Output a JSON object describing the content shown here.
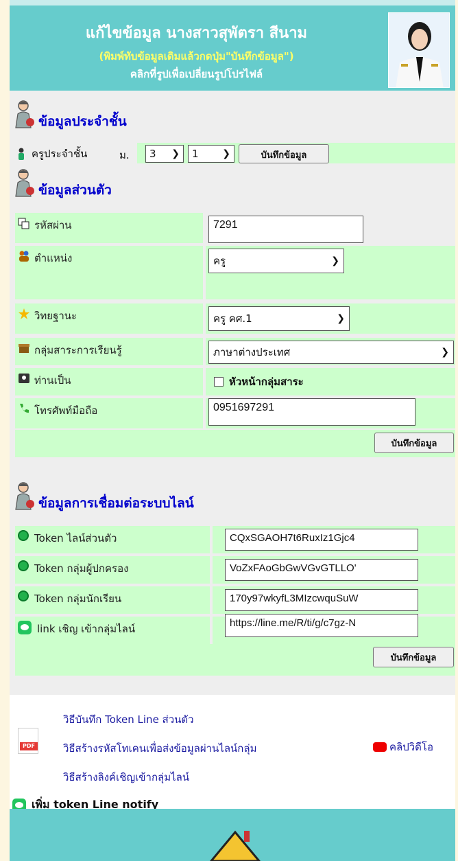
{
  "header": {
    "title": "แก้ไขข้อมูล นางสาวสุพัตรา สีนาม",
    "subtitle": "(พิมพ์ทับข้อมูลเดิมแล้วกดปุ่ม\"บันทึกข้อมูล\")",
    "click_hint": "คลิกที่รูปเพื่อเปลี่ยนรูปโปรไฟล์"
  },
  "class_section": {
    "title": "ข้อมูลประจำชั้น",
    "teacher_label": "ครูประจำชั้น",
    "level_prefix": "ม.",
    "level_value": "3",
    "room_value": "1",
    "save_label": "บันทึกข้อมูล"
  },
  "personal_section": {
    "title": "ข้อมูลส่วนตัว",
    "password_label": "รหัสผ่าน",
    "password_value": "7291",
    "position_label": "ตำแหน่ง",
    "position_value": "ครู",
    "rank_label": "วิทยฐานะ",
    "rank_value": "ครู คศ.1",
    "group_label": "กลุ่มสาระการเรียนรู้",
    "group_value": "ภาษาต่างประเทศ",
    "role_label": "ท่านเป็น",
    "role_option": "หัวหน้ากลุ่มสาระ",
    "phone_label": "โทรศัพท์มือถือ",
    "phone_value": "0951697291",
    "save_label": "บันทึกข้อมูล"
  },
  "line_section": {
    "title": "ข้อมูลการเชื่อมต่อระบบไลน์",
    "rows": [
      {
        "label": "Token ไลน์ส่วนตัว",
        "value": "CQxSGAOH7t6RuxIz1Gjc4"
      },
      {
        "label": "Token กลุ่มผู้ปกครอง",
        "value": "VoZxFAoGbGwVGvGTLLO'"
      },
      {
        "label": "Token กลุ่มนักเรียน",
        "value": "170y97wkyfL3MIzcwquSuW"
      },
      {
        "label": "link เชิญ เข้ากลุ่มไลน์",
        "value": "https://line.me/R/ti/g/c7gz-N"
      }
    ],
    "save_label": "บันทึกข้อมูล"
  },
  "help_links": {
    "link1": "วิธีบันทึก Token Line ส่วนตัว",
    "link2": "วิธีสร้างรหัสโทเคนเพื่อส่งข้อมูลผ่านไลน์กลุ่ม",
    "link3": "วิธีสร้างลิงค์เชิญเข้ากลุ่มไลน์",
    "video": "คลิปวิดีโอ",
    "pdf_tag": "PDF",
    "add_token": "เพิ่ม token Line notify"
  },
  "colors": {
    "header": "#66cccc",
    "green": "#ccffcc",
    "title_blue": "#0000cc"
  }
}
